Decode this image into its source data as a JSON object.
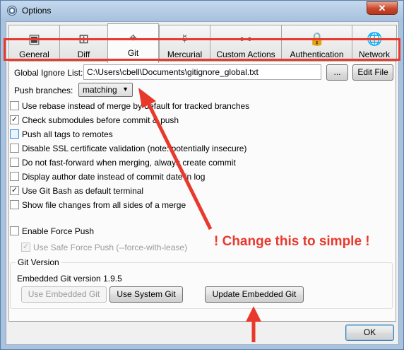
{
  "window": {
    "title": "Options",
    "close_glyph": "✕"
  },
  "tabs": [
    {
      "label": "General",
      "icon": "switch-icon",
      "glyph": "▣"
    },
    {
      "label": "Diff",
      "icon": "diff-icon",
      "glyph": "⊞"
    },
    {
      "label": "Git",
      "icon": "git-icon",
      "glyph": "⌖"
    },
    {
      "label": "Mercurial",
      "icon": "mercurial-icon",
      "glyph": "☿"
    },
    {
      "label": "Custom Actions",
      "icon": "flowchart-icon",
      "glyph": "⊶"
    },
    {
      "label": "Authentication",
      "icon": "lock-icon",
      "glyph": "🔒"
    },
    {
      "label": "Network",
      "icon": "globe-icon",
      "glyph": "🌐"
    }
  ],
  "selected_tab": "Git",
  "git": {
    "global_ignore_label": "Global Ignore List:",
    "global_ignore_value": "C:\\Users\\cbell\\Documents\\gitignore_global.txt",
    "browse_label": "...",
    "edit_file_label": "Edit File",
    "push_branches_label": "Push branches:",
    "push_branches_value": "matching",
    "options": [
      {
        "label": "Use rebase instead of merge by default for tracked branches",
        "checked": false
      },
      {
        "label": "Check submodules before commit & push",
        "checked": true
      },
      {
        "label": "Push all tags to remotes",
        "checked": false
      },
      {
        "label": "Disable SSL certificate validation (note: potentially insecure)",
        "checked": false
      },
      {
        "label": "Do not fast-forward when merging, always create commit",
        "checked": false
      },
      {
        "label": "Display author date instead of commit date in log",
        "checked": false
      },
      {
        "label": "Use Git Bash as default terminal",
        "checked": true
      },
      {
        "label": "Show file changes from all sides of a merge",
        "checked": false
      }
    ],
    "force_push_label": "Enable Force Push",
    "safe_force_push_label": "Use Safe Force Push (--force-with-lease)",
    "git_version_group": "Git Version",
    "embedded_version_text": "Embedded Git version 1.9.5",
    "use_embedded_label": "Use Embedded Git",
    "use_system_label": "Use System Git",
    "update_embedded_label": "Update Embedded Git"
  },
  "ok_label": "OK",
  "annotation": {
    "text": "! Change this to simple !",
    "color": "#e8392d"
  },
  "colors": {
    "highlight": "#e8392d",
    "title_bar": "#a9c3de",
    "panel": "#fbfbfb"
  }
}
